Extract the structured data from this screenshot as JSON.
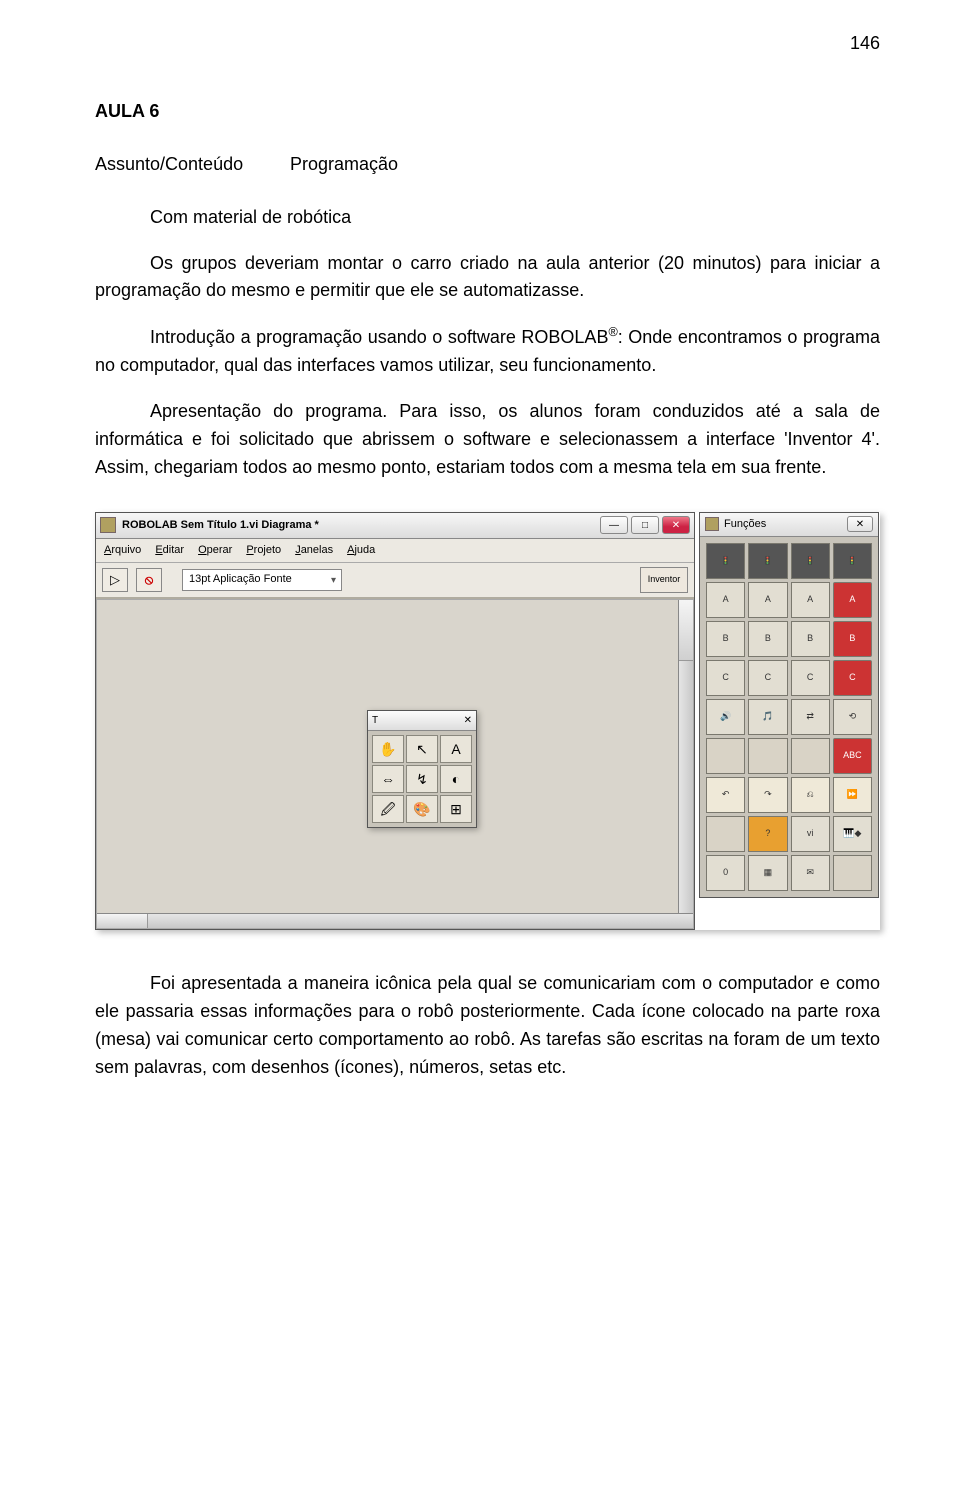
{
  "page_number": "146",
  "heading": "AULA 6",
  "subject_label": "Assunto/Conteúdo",
  "subject_value": "Programação",
  "para1": "Com material de robótica",
  "para2": "Os grupos deveriam montar o carro criado na aula anterior (20 minutos) para iniciar a programação do mesmo e permitir que ele se automatizasse.",
  "para3_prefix": "Introdução a programação usando o software ROBOLAB",
  "para3_sup": "®",
  "para3_suffix": ": Onde encontramos o programa no computador, qual das interfaces vamos utilizar, seu funcionamento.",
  "para4": "Apresentação do programa. Para isso, os alunos foram conduzidos até a sala de informática e foi solicitado que abrissem o software e selecionassem a interface 'Inventor 4'. Assim, chegariam todos ao mesmo ponto, estariam todos com a mesma tela em sua frente.",
  "para5": "Foi apresentada a maneira icônica pela qual se comunicariam com o computador e como ele passaria essas informações para o robô posteriormente. Cada ícone colocado na parte roxa (mesa) vai comunicar certo comportamento ao robô. As tarefas são escritas na foram de um texto sem palavras, com desenhos (ícones), números, setas etc.",
  "win": {
    "title": "ROBOLAB Sem Título 1.vi Diagrama *",
    "menus": [
      "Arquivo",
      "Editar",
      "Operar",
      "Projeto",
      "Janelas",
      "Ajuda"
    ],
    "font_combo": "13pt Aplicação Fonte",
    "inventor_btn": "Inventor",
    "toolbar": {
      "run": "▷",
      "abort": "⦸"
    }
  },
  "tools_palette": {
    "title": "T",
    "cells": [
      "✋",
      "↖",
      "A",
      "⇔",
      "↯",
      "◐",
      "🖉",
      "🎨",
      "⊞"
    ]
  },
  "func_palette": {
    "title": "Funções",
    "rows": [
      [
        "🚦",
        "🚦",
        "🚦",
        "🚦"
      ],
      [
        "A",
        "A",
        "A",
        "A"
      ],
      [
        "B",
        "B",
        "B",
        "B"
      ],
      [
        "C",
        "C",
        "C",
        "C"
      ],
      [
        "🔊",
        "🎵",
        "⇄",
        "⟲"
      ],
      [
        "",
        "",
        "",
        "ABC"
      ],
      [
        "↶",
        "↷",
        "⎌",
        "⏩"
      ],
      [
        "",
        "?",
        "vi",
        "🎹◆"
      ],
      [
        "0",
        "▦",
        "✉",
        ""
      ]
    ]
  }
}
